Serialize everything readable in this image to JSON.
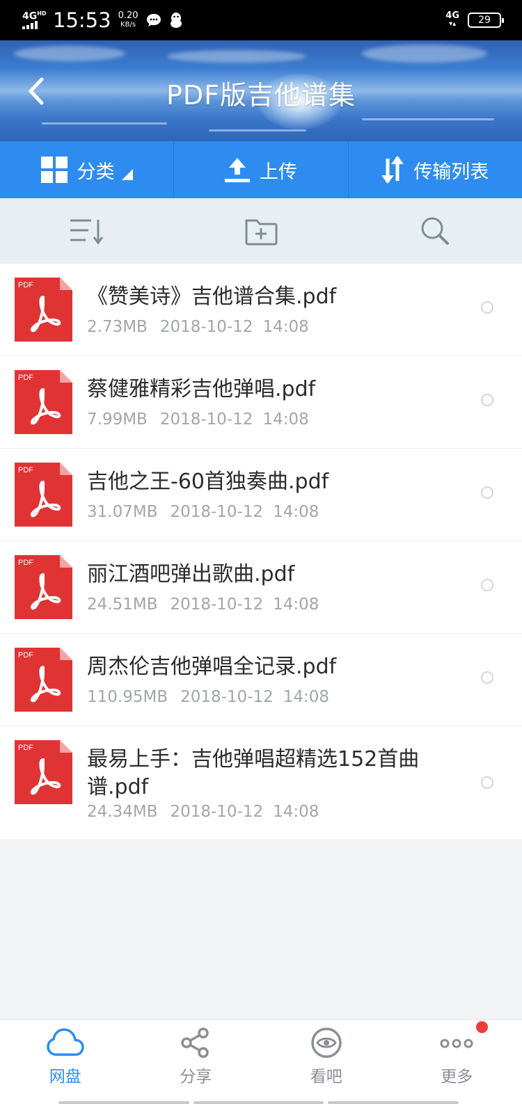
{
  "status_bar": {
    "network": "4G",
    "network_sub": "HD",
    "time": "15:53",
    "speed_value": "0.20",
    "speed_unit": "KB/s",
    "net_right": "4G",
    "battery": "29"
  },
  "header": {
    "title": "PDF版吉他谱集"
  },
  "actions": {
    "category_label": "分类",
    "upload_label": "上传",
    "transfer_label": "传输列表"
  },
  "files": [
    {
      "name": "《赞美诗》吉他谱合集.pdf",
      "size": "2.73MB",
      "date": "2018-10-12",
      "time": "14:08"
    },
    {
      "name": "蔡健雅精彩吉他弹唱.pdf",
      "size": "7.99MB",
      "date": "2018-10-12",
      "time": "14:08"
    },
    {
      "name": "吉他之王-60首独奏曲.pdf",
      "size": "31.07MB",
      "date": "2018-10-12",
      "time": "14:08"
    },
    {
      "name": "丽江酒吧弹出歌曲.pdf",
      "size": "24.51MB",
      "date": "2018-10-12",
      "time": "14:08"
    },
    {
      "name": "周杰伦吉他弹唱全记录.pdf",
      "size": "110.95MB",
      "date": "2018-10-12",
      "time": "14:08"
    },
    {
      "name": "最易上手：吉他弹唱超精选152首曲谱.pdf",
      "size": "24.34MB",
      "date": "2018-10-12",
      "time": "14:08"
    }
  ],
  "pdf_badge": "PDF",
  "tabs": [
    {
      "label": "网盘",
      "icon": "cloud-icon"
    },
    {
      "label": "分享",
      "icon": "share-icon"
    },
    {
      "label": "看吧",
      "icon": "eye-icon"
    },
    {
      "label": "更多",
      "icon": "more-icon"
    }
  ],
  "colors": {
    "accent": "#2e8cf0",
    "pdf_red": "#e03334",
    "badge_red": "#ef3b3b"
  }
}
